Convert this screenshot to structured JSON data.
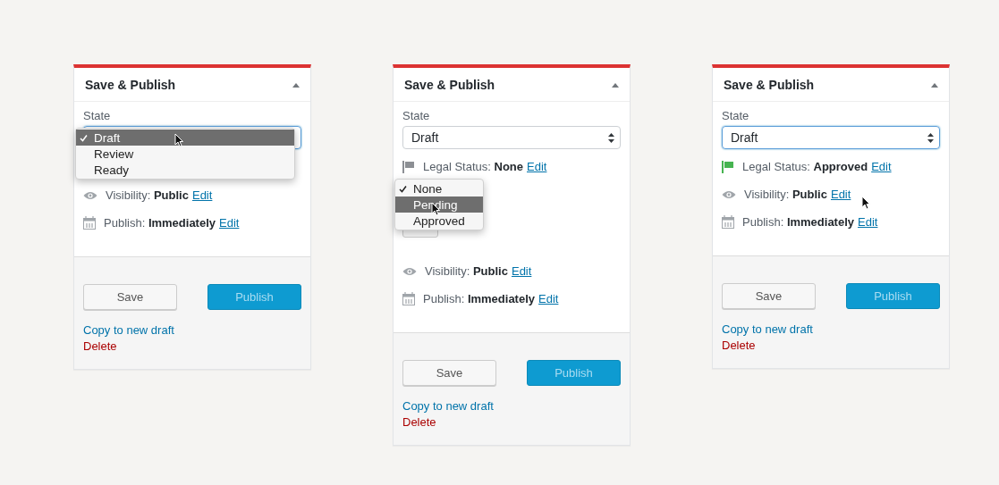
{
  "panels": [
    {
      "title": "Save & Publish",
      "state": {
        "label": "State",
        "focused": true,
        "options": [
          {
            "label": "Draft",
            "selected": true,
            "highlighted": true
          },
          {
            "label": "Review",
            "selected": false,
            "highlighted": false
          },
          {
            "label": "Ready",
            "selected": false,
            "highlighted": false
          }
        ]
      },
      "rows": [
        {
          "kind": "visibility",
          "label": "Visibility:",
          "value": "Public",
          "link": "Edit"
        },
        {
          "kind": "publish",
          "label": "Publish:",
          "value": "Immediately",
          "link": "Edit"
        }
      ],
      "buttons": {
        "save": "Save",
        "publish": "Publish"
      },
      "links": [
        {
          "kind": "copy",
          "label": "Copy to new draft"
        },
        {
          "kind": "delete",
          "label": "Delete"
        }
      ]
    },
    {
      "title": "Save & Publish",
      "state": {
        "label": "State",
        "focused": false,
        "value": "Draft"
      },
      "rows": [
        {
          "kind": "legal",
          "label": "Legal Status:",
          "value": "None",
          "link": "Edit",
          "color": "#8c8f94",
          "options": [
            {
              "label": "None",
              "selected": true,
              "highlighted": false
            },
            {
              "label": "Pending",
              "selected": false,
              "highlighted": true
            },
            {
              "label": "Approved",
              "selected": false,
              "highlighted": false
            }
          ]
        },
        {
          "kind": "visibility",
          "label": "Visibility:",
          "value": "Public",
          "link": "Edit"
        },
        {
          "kind": "publish",
          "label": "Publish:",
          "value": "Immediately",
          "link": "Edit"
        }
      ],
      "buttons": {
        "save": "Save",
        "publish": "Publish"
      },
      "links": [
        {
          "kind": "copy",
          "label": "Copy to new draft"
        },
        {
          "kind": "delete",
          "label": "Delete"
        }
      ]
    },
    {
      "title": "Save & Publish",
      "state": {
        "label": "State",
        "focused": true,
        "value": "Draft"
      },
      "pointer": true,
      "rows": [
        {
          "kind": "legal",
          "label": "Legal Status:",
          "value": "Approved",
          "link": "Edit",
          "color": "#46b450"
        },
        {
          "kind": "visibility",
          "label": "Visibility:",
          "value": "Public",
          "link": "Edit"
        },
        {
          "kind": "publish",
          "label": "Publish:",
          "value": "Immediately",
          "link": "Edit"
        }
      ],
      "buttons": {
        "save": "Save",
        "publish": "Publish"
      },
      "links": [
        {
          "kind": "copy",
          "label": "Copy to new draft"
        },
        {
          "kind": "delete",
          "label": "Delete"
        }
      ]
    }
  ]
}
